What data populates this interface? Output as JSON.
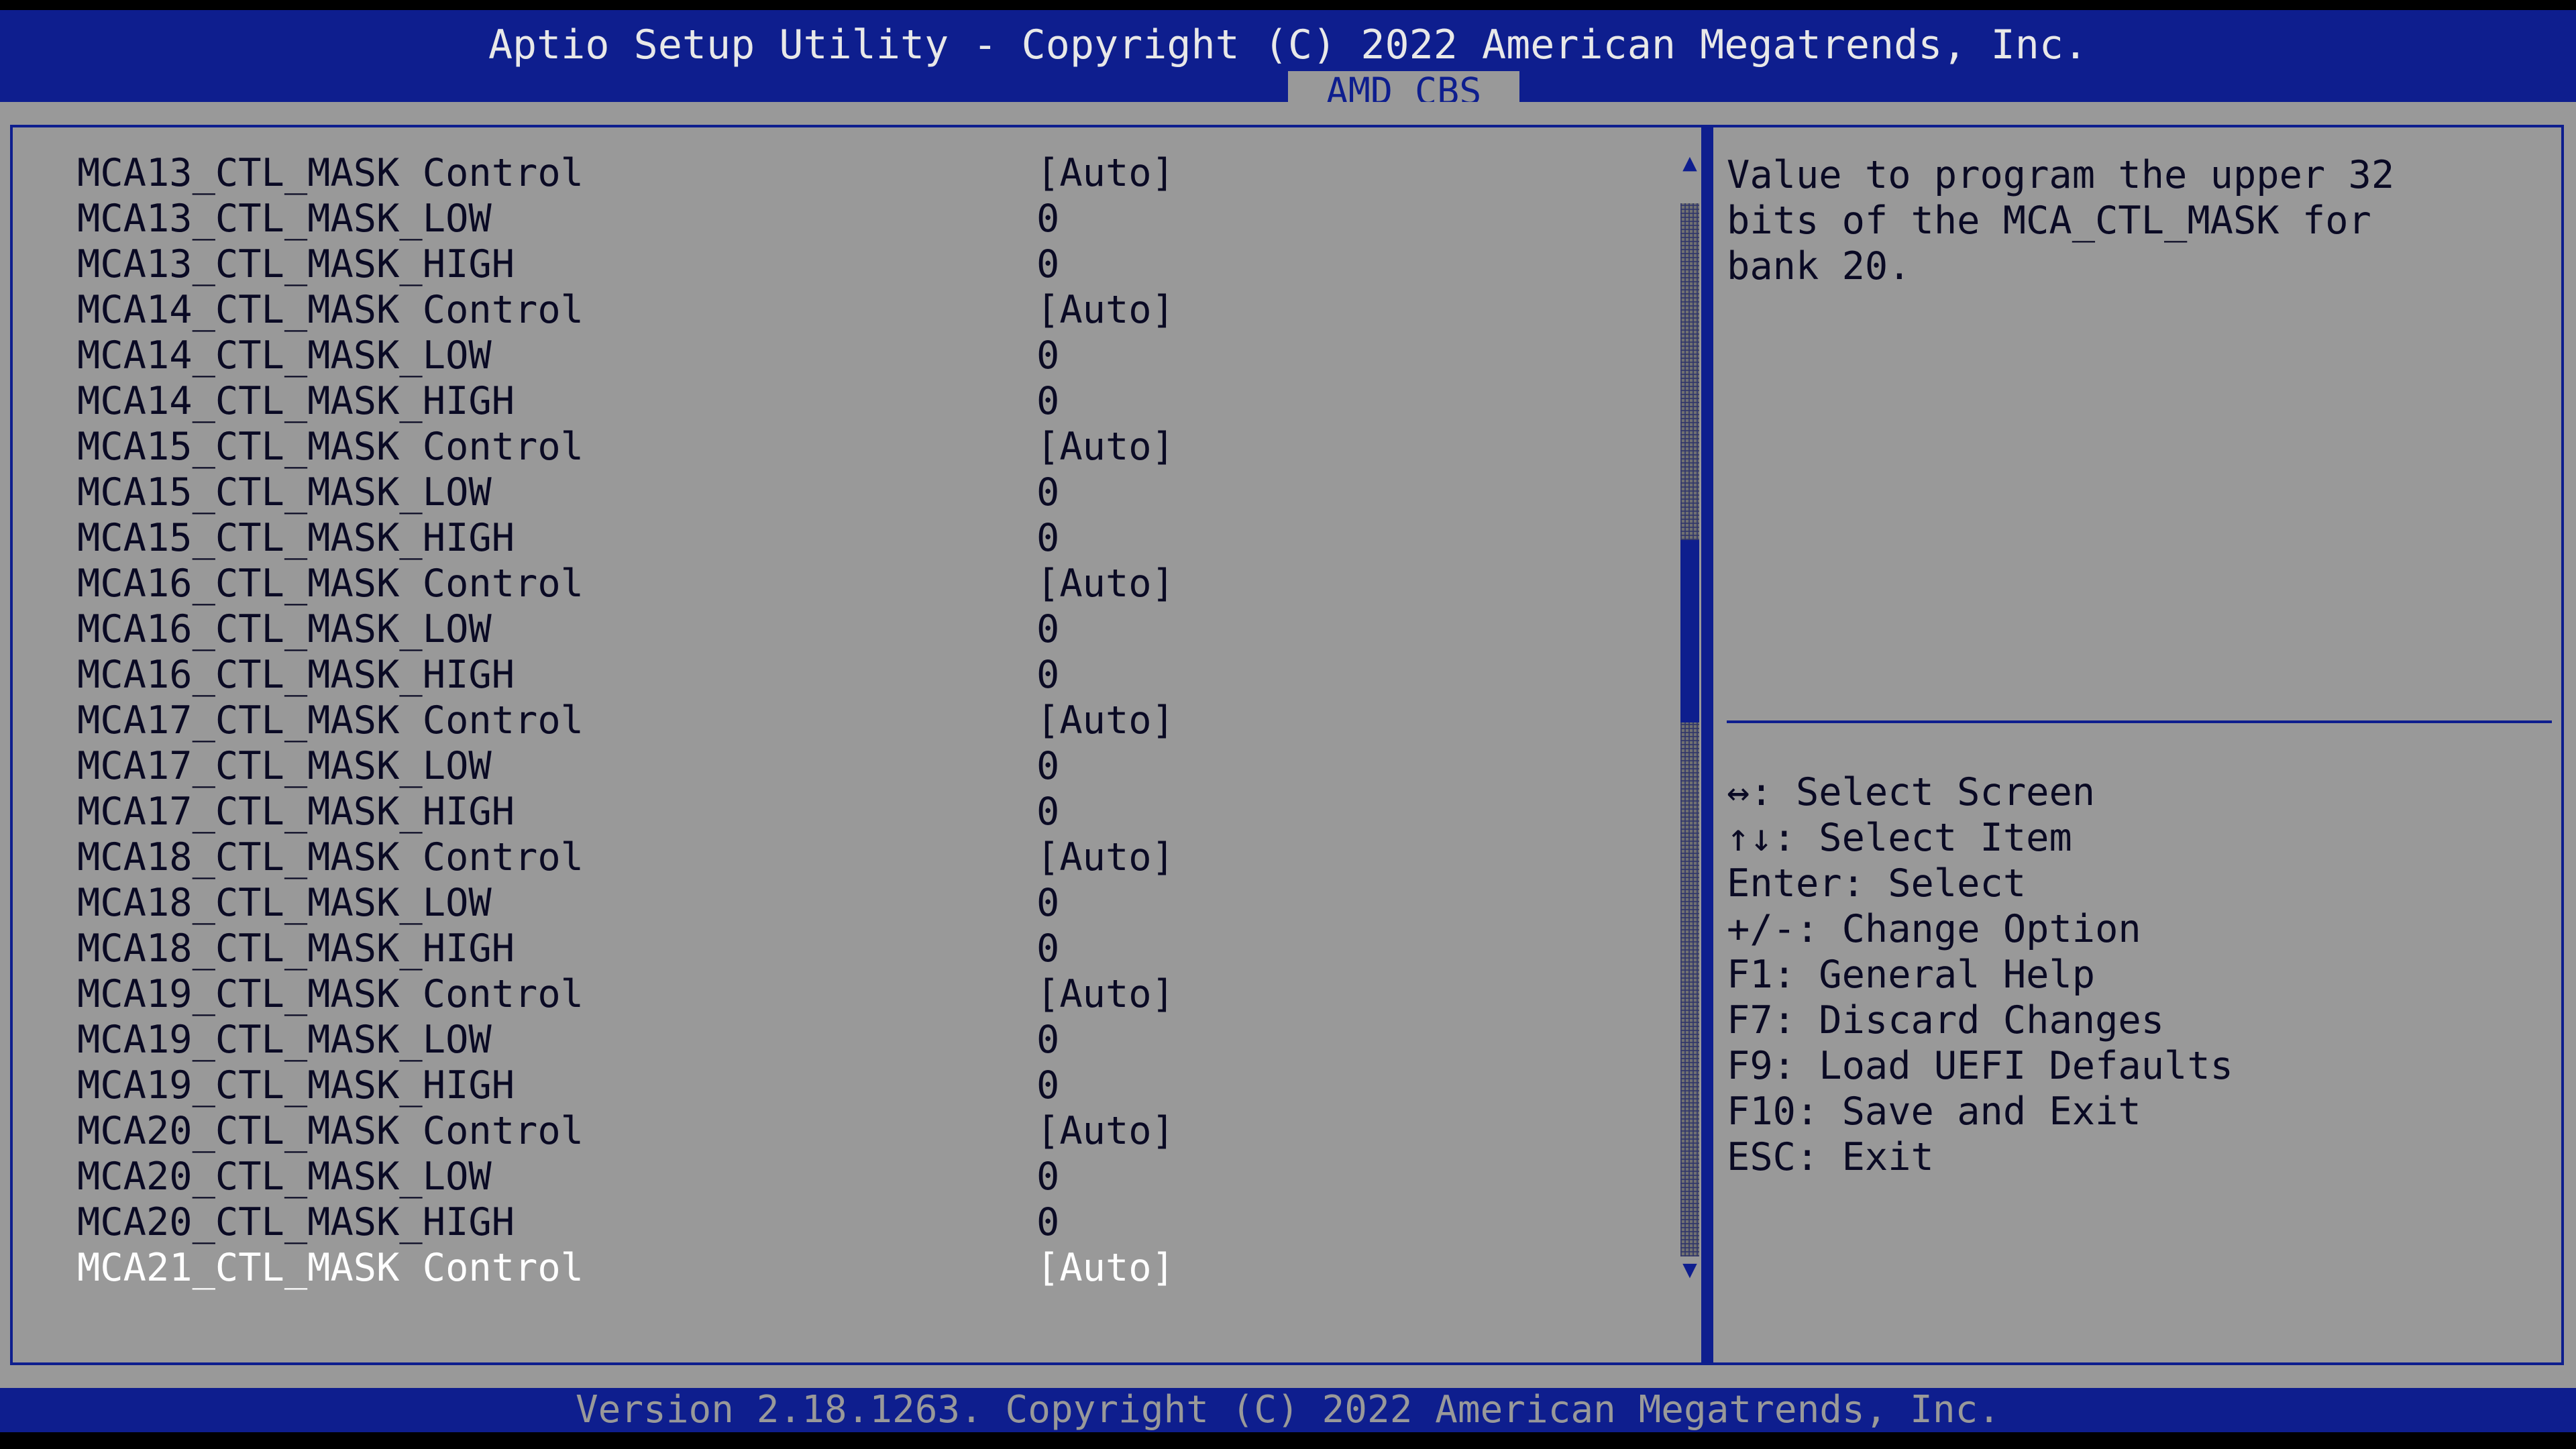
{
  "header": {
    "title": "Aptio Setup Utility - Copyright (C) 2022 American Megatrends, Inc.",
    "active_tab": "AMD CBS"
  },
  "settings": {
    "rows": [
      {
        "label": "MCA13_CTL_MASK Control",
        "value": "[Auto]"
      },
      {
        "label": "MCA13_CTL_MASK_LOW",
        "value": "0"
      },
      {
        "label": "MCA13_CTL_MASK_HIGH",
        "value": "0"
      },
      {
        "label": "MCA14_CTL_MASK Control",
        "value": "[Auto]"
      },
      {
        "label": "MCA14_CTL_MASK_LOW",
        "value": "0"
      },
      {
        "label": "MCA14_CTL_MASK_HIGH",
        "value": "0"
      },
      {
        "label": "MCA15_CTL_MASK Control",
        "value": "[Auto]"
      },
      {
        "label": "MCA15_CTL_MASK_LOW",
        "value": "0"
      },
      {
        "label": "MCA15_CTL_MASK_HIGH",
        "value": "0"
      },
      {
        "label": "MCA16_CTL_MASK Control",
        "value": "[Auto]"
      },
      {
        "label": "MCA16_CTL_MASK_LOW",
        "value": "0"
      },
      {
        "label": "MCA16_CTL_MASK_HIGH",
        "value": "0"
      },
      {
        "label": "MCA17_CTL_MASK Control",
        "value": "[Auto]"
      },
      {
        "label": "MCA17_CTL_MASK_LOW",
        "value": "0"
      },
      {
        "label": "MCA17_CTL_MASK_HIGH",
        "value": "0"
      },
      {
        "label": "MCA18_CTL_MASK Control",
        "value": "[Auto]"
      },
      {
        "label": "MCA18_CTL_MASK_LOW",
        "value": "0"
      },
      {
        "label": "MCA18_CTL_MASK_HIGH",
        "value": "0"
      },
      {
        "label": "MCA19_CTL_MASK Control",
        "value": "[Auto]"
      },
      {
        "label": "MCA19_CTL_MASK_LOW",
        "value": "0"
      },
      {
        "label": "MCA19_CTL_MASK_HIGH",
        "value": "0"
      },
      {
        "label": "MCA20_CTL_MASK Control",
        "value": "[Auto]"
      },
      {
        "label": "MCA20_CTL_MASK_LOW",
        "value": "0"
      },
      {
        "label": "MCA20_CTL_MASK_HIGH",
        "value": "0"
      },
      {
        "label": "MCA21_CTL_MASK Control",
        "value": "[Auto]"
      }
    ],
    "selected_row": 24
  },
  "scrollbar": {
    "up_glyph": "▲",
    "down_glyph": "▼",
    "up_icon": "arrow-up-icon",
    "down_icon": "arrow-down-icon"
  },
  "help": {
    "description": "Value to program the upper 32\nbits of the MCA_CTL_MASK for\nbank 20.",
    "keys": [
      {
        "key": "↔:",
        "action": "Select Screen"
      },
      {
        "key": "↑↓:",
        "action": "Select Item"
      },
      {
        "key": "Enter:",
        "action": "Select"
      },
      {
        "key": "+/-:",
        "action": "Change Option"
      },
      {
        "key": "F1:",
        "action": "General Help"
      },
      {
        "key": "F7:",
        "action": "Discard Changes"
      },
      {
        "key": "F9:",
        "action": "Load UEFI Defaults"
      },
      {
        "key": "F10:",
        "action": "Save and Exit"
      },
      {
        "key": "ESC:",
        "action": "Exit"
      }
    ]
  },
  "footer": {
    "text": "Version 2.18.1263. Copyright (C) 2022 American Megatrends, Inc."
  },
  "colors": {
    "bar_blue": "#0e1e8e",
    "panel_gray": "#999999",
    "text_dark": "#0a0a24",
    "selected_text": "#ffffff"
  }
}
